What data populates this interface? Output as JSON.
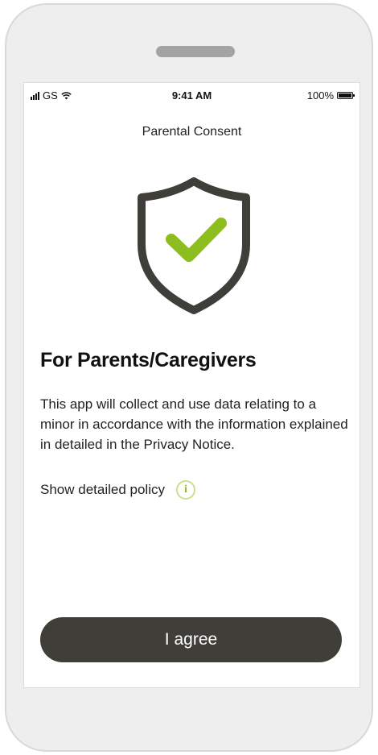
{
  "status_bar": {
    "carrier": "GS",
    "time": "9:41 AM",
    "battery": "100%"
  },
  "nav": {
    "title": "Parental Consent"
  },
  "hero": {
    "icon": "shield-check-icon",
    "shield_color": "#3f3e39",
    "check_color": "#8dbd1f"
  },
  "content": {
    "heading": "For Parents/Caregivers",
    "body": "This app will collect and use data relating to a minor in accordance with the information explained in detailed in the Privacy Notice.",
    "policy_label": "Show detailed policy",
    "info_glyph": "i"
  },
  "actions": {
    "agree_label": "I agree",
    "agree_color": "#3f3e39"
  }
}
